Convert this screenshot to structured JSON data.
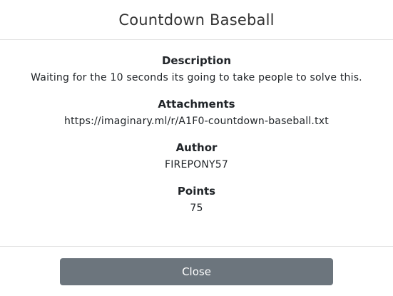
{
  "modal": {
    "title": "Countdown Baseball",
    "close_label": "Close"
  },
  "fields": {
    "description": {
      "label": "Description",
      "value": "Waiting for the 10 seconds its going to take people to solve this."
    },
    "attachments": {
      "label": "Attachments",
      "value": "https://imaginary.ml/r/A1F0-countdown-baseball.txt"
    },
    "author": {
      "label": "Author",
      "value": "FIREPONY57"
    },
    "points": {
      "label": "Points",
      "value": "75"
    }
  },
  "colors": {
    "button_bg": "#6c757d",
    "divider": "#e4e4e4",
    "text": "#212529"
  }
}
